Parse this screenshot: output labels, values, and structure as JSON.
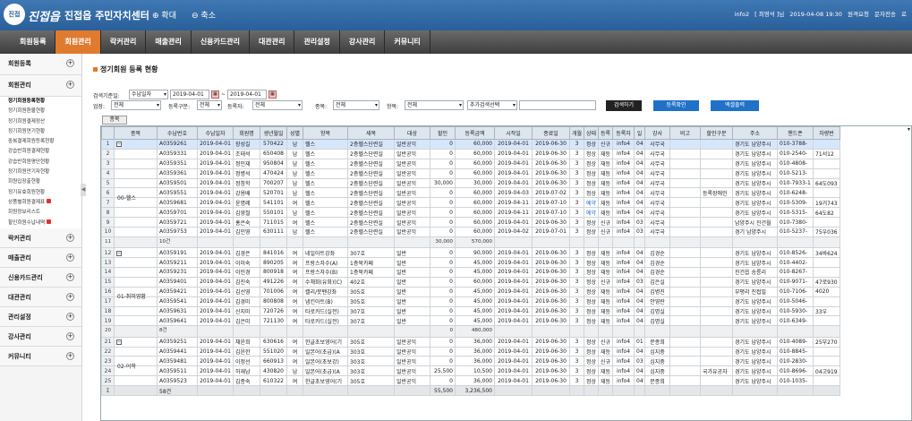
{
  "header": {
    "logo": "진접",
    "brand": "진접읍",
    "title": "진접읍 주민자치센터",
    "zoom_in": "확대",
    "zoom_out": "축소",
    "info": [
      "info2",
      "[ 최영석 ]님",
      "2019-04-08 19:30",
      "원격요청",
      "문자전송",
      "로"
    ]
  },
  "nav": [
    "회원등록",
    "회원관리",
    "락커관리",
    "매출관리",
    "신용카드관리",
    "대관관리",
    "관리설정",
    "강사관리",
    "커뮤니티"
  ],
  "nav_active": 1,
  "sidebar": {
    "top": [
      "회원등록",
      "회원관리"
    ],
    "subs": [
      "정기회원등록현황",
      "정기회원환불현황",
      "정기회원결제정산",
      "정기회원연기현황",
      "중복결제회원등록현황",
      "강습반회원결제현황",
      "강습반회원명단현황",
      "정기회원만기자현황",
      "회원입장출현황",
      "정기유효회원현황",
      "상품별회원결제표",
      "회원정보리스트",
      "할인회원수납내역"
    ],
    "locked": [
      10,
      12
    ],
    "bottom": [
      "락커관리",
      "매출관리",
      "신용카드관리",
      "대관관리",
      "관리설정",
      "강사관리",
      "커뮤니티"
    ]
  },
  "page": {
    "title": "정기회원 등록 현황"
  },
  "filters": {
    "period_label": "검색기준일:",
    "period_type": "수납일자",
    "date_from": "2019-04-01",
    "date_to": "2019-04-01",
    "business_label": "업장:",
    "business": "전체",
    "reg_label": "등록구분:",
    "reg": "전체",
    "reg_user_label": "등록자:",
    "reg_user": "전체",
    "type_label": "종목:",
    "type": "전체",
    "item_label": "항목:",
    "item": "전체",
    "extra": "추가검색선택"
  },
  "buttons": {
    "search": "검색하기",
    "register": "등록확인",
    "excel": "엑셀출력",
    "group": "종목"
  },
  "columns": [
    "",
    "종목",
    "수납번호",
    "수납일자",
    "회원명",
    "생년월일",
    "성별",
    "항목",
    "세목",
    "대상",
    "할인",
    "등록금액",
    "시작일",
    "종료일",
    "개월",
    "상태",
    "등록",
    "등록자",
    "일",
    "강사",
    "비고",
    "할인구분",
    "주소",
    "핸드폰",
    "차량번"
  ],
  "rows": [
    {
      "rn": "1",
      "g": "⊟",
      "no": "A0359261",
      "d": "2019-04-01",
      "n": "장성길",
      "b": "570422",
      "s": "남",
      "i": "헬스",
      "t": "2층헬스단련실",
      "tg": "일반공익",
      "dc": "0",
      "amt": "60,000",
      "st": "2019-04-01",
      "en": "2019-06-30",
      "m": "3",
      "ss": "정상",
      "rg": "신규",
      "ru": "info4",
      "dy": "04",
      "tc": "사무국",
      "nt": "",
      "dk": "",
      "ad": "경기도 남양주시",
      "ph": "010-3788-",
      "car": ""
    },
    {
      "rn": "2",
      "g": "",
      "no": "A0359331",
      "d": "2019-04-01",
      "n": "조태석",
      "b": "650408",
      "s": "남",
      "i": "헬스",
      "t": "2층헬스단련실",
      "tg": "일반공익",
      "dc": "0",
      "amt": "60,000",
      "st": "2019-04-01",
      "en": "2019-06-30",
      "m": "3",
      "ss": "정상",
      "rg": "재등",
      "ru": "info4",
      "dy": "04",
      "tc": "사무국",
      "nt": "",
      "dk": "",
      "ad": "경기도 남양주시",
      "ph": "010-2540-",
      "car": "71서12"
    },
    {
      "rn": "3",
      "g": "",
      "no": "A0359351",
      "d": "2019-04-01",
      "n": "정민재",
      "b": "950804",
      "s": "남",
      "i": "헬스",
      "t": "2층헬스단련실",
      "tg": "일반공익",
      "dc": "0",
      "amt": "60,000",
      "st": "2019-04-01",
      "en": "2019-06-30",
      "m": "3",
      "ss": "정상",
      "rg": "재등",
      "ru": "info4",
      "dy": "04",
      "tc": "사무국",
      "nt": "",
      "dk": "",
      "ad": "경기도 남양주시",
      "ph": "010-4808-",
      "car": ""
    },
    {
      "rn": "4",
      "g": "",
      "no": "A0359361",
      "d": "2019-04-01",
      "n": "정병석",
      "b": "470424",
      "s": "남",
      "i": "헬스",
      "t": "2층헬스단련실",
      "tg": "일반공익",
      "dc": "0",
      "amt": "60,000",
      "st": "2019-04-01",
      "en": "2019-06-30",
      "m": "3",
      "ss": "정상",
      "rg": "재등",
      "ru": "info4",
      "dy": "04",
      "tc": "사무국",
      "nt": "",
      "dk": "",
      "ad": "경기도 남양주시",
      "ph": "010-5213-",
      "car": ""
    },
    {
      "rn": "5",
      "g": "",
      "no": "A0359501",
      "d": "2019-04-01",
      "n": "정창학",
      "b": "700207",
      "s": "남",
      "i": "헬스",
      "t": "2층헬스단련실",
      "tg": "일반공익",
      "dc": "30,000",
      "amt": "30,000",
      "st": "2019-04-01",
      "en": "2019-06-30",
      "m": "3",
      "ss": "정상",
      "rg": "재등",
      "ru": "info4",
      "dy": "04",
      "tc": "사무국",
      "nt": "",
      "dk": "",
      "ad": "경기도 남양주시",
      "ph": "010-7933-1",
      "car": "64도093"
    },
    {
      "rn": "6",
      "g": "",
      "no": "A0359551",
      "d": "2019-04-01",
      "n": "강용배",
      "b": "520701",
      "s": "남",
      "i": "헬스",
      "t": "2층헬스단련실",
      "tg": "일반공익",
      "dc": "0",
      "amt": "60,000",
      "st": "2019-04-03",
      "en": "2019-07-02",
      "m": "3",
      "ss": "정상",
      "rg": "재등",
      "ru": "info4",
      "dy": "04",
      "tc": "사무국",
      "nt": "",
      "dk": "등록장애인",
      "ad": "경기도 남양주시",
      "ph": "010-6248-",
      "car": ""
    },
    {
      "rn": "7",
      "g": "",
      "no": "A0359681",
      "d": "2019-04-01",
      "n": "윤명례",
      "b": "541101",
      "s": "여",
      "i": "헬스",
      "t": "2층헬스단련실",
      "tg": "일반공익",
      "dc": "0",
      "amt": "60,000",
      "st": "2019-04-11",
      "en": "2019-07-10",
      "m": "3",
      "ss": "예약",
      "rg": "재등",
      "ru": "info4",
      "dy": "04",
      "tc": "사무국",
      "nt": "",
      "dk": "",
      "ad": "경기도 남양주시",
      "ph": "010-5309-",
      "car": "19거743"
    },
    {
      "rn": "8",
      "g": "",
      "no": "A0359701",
      "d": "2019-04-01",
      "n": "김영철",
      "b": "550101",
      "s": "남",
      "i": "헬스",
      "t": "2층헬스단련실",
      "tg": "일반공익",
      "dc": "0",
      "amt": "60,000",
      "st": "2019-04-11",
      "en": "2019-07-10",
      "m": "3",
      "ss": "예약",
      "rg": "재등",
      "ru": "info4",
      "dy": "04",
      "tc": "사무국",
      "nt": "",
      "dk": "",
      "ad": "경기도 남양주시",
      "ph": "010-5315-",
      "car": "64도82"
    },
    {
      "rn": "9",
      "g": "",
      "no": "A0359721",
      "d": "2019-04-01",
      "n": "홍은숙",
      "b": "711015",
      "s": "여",
      "i": "헬스",
      "t": "2층헬스단련실",
      "tg": "일반공익",
      "dc": "0",
      "amt": "60,000",
      "st": "2019-04-01",
      "en": "2019-06-30",
      "m": "3",
      "ss": "정상",
      "rg": "신규",
      "ru": "info4",
      "dy": "03",
      "tc": "사무국",
      "nt": "",
      "dk": "",
      "ad": "남양주시 진건월",
      "ph": "010-7380-",
      "car": ""
    },
    {
      "rn": "10",
      "g": "",
      "no": "A0359753",
      "d": "2019-04-01",
      "n": "김민영",
      "b": "630111",
      "s": "남",
      "i": "헬스",
      "t": "2층헬스단련실",
      "tg": "일반공익",
      "dc": "0",
      "amt": "60,000",
      "st": "2019-04-02",
      "en": "2019-07-01",
      "m": "3",
      "ss": "정상",
      "rg": "신규",
      "ru": "info4",
      "dy": "03",
      "tc": "사무국",
      "nt": "",
      "dk": "",
      "ad": "경기 남양주시",
      "ph": "010-5237-",
      "car": "75우036"
    },
    {
      "rn": "11",
      "cls": "sub",
      "g": "",
      "no": "10건",
      "d": "",
      "n": "",
      "b": "",
      "s": "",
      "i": "",
      "t": "",
      "tg": "",
      "dc": "30,000",
      "amt": "570,000",
      "st": "",
      "en": "",
      "m": "",
      "ss": "",
      "rg": "",
      "ru": "",
      "dy": "",
      "tc": "",
      "nt": "",
      "dk": "",
      "ad": "",
      "ph": "",
      "car": ""
    },
    {
      "rn": "12",
      "g": "⊟",
      "no": "A0359191",
      "d": "2019-04-01",
      "n": "김경은",
      "b": "841016",
      "s": "여",
      "i": "네일아트강좌",
      "t": "307호",
      "tg": "일반",
      "dc": "0",
      "amt": "90,000",
      "st": "2019-04-01",
      "en": "2019-06-30",
      "m": "3",
      "ss": "정상",
      "rg": "재등",
      "ru": "info4",
      "dy": "04",
      "tc": "김경순",
      "nt": "",
      "dk": "",
      "ad": "경기도 남양주시",
      "ph": "010-8526-",
      "car": "34바624"
    },
    {
      "rn": "13",
      "g": "",
      "no": "A0359211",
      "d": "2019-04-01",
      "n": "이미숙",
      "b": "890205",
      "s": "여",
      "i": "프랑스자수(A)",
      "t": "1층북카페",
      "tg": "일반",
      "dc": "0",
      "amt": "45,000",
      "st": "2019-04-01",
      "en": "2019-06-30",
      "m": "3",
      "ss": "정상",
      "rg": "재등",
      "ru": "info4",
      "dy": "04",
      "tc": "김경순",
      "nt": "",
      "dk": "",
      "ad": "경기도 남양주시",
      "ph": "010-4402-",
      "car": ""
    },
    {
      "rn": "14",
      "g": "",
      "no": "A0359231",
      "d": "2019-04-01",
      "n": "이민경",
      "b": "800918",
      "s": "여",
      "i": "프랑스자수(B)",
      "t": "1층북카페",
      "tg": "일반",
      "dc": "0",
      "amt": "45,000",
      "st": "2019-04-01",
      "en": "2019-06-30",
      "m": "3",
      "ss": "정상",
      "rg": "재등",
      "ru": "info4",
      "dy": "04",
      "tc": "김경순",
      "nt": "",
      "dk": "",
      "ad": "진건읍 송릉리",
      "ph": "010-8267-",
      "car": ""
    },
    {
      "rn": "15",
      "g": "",
      "no": "A0359401",
      "d": "2019-04-01",
      "n": "김진숙",
      "b": "491226",
      "s": "여",
      "i": "수채화(유화)(C)",
      "t": "402호",
      "tg": "일반",
      "dc": "0",
      "amt": "60,000",
      "st": "2019-04-01",
      "en": "2019-06-30",
      "m": "3",
      "ss": "정상",
      "rg": "신규",
      "ru": "info4",
      "dy": "03",
      "tc": "김은실",
      "nt": "",
      "dk": "",
      "ad": "경기도 남양주시",
      "ph": "010-9071-",
      "car": "47로930"
    },
    {
      "rn": "16",
      "g": "",
      "no": "A0359421",
      "d": "2019-04-01",
      "n": "김선영",
      "b": "701006",
      "s": "여",
      "i": "캘리/붓펜강좌",
      "t": "305호",
      "tg": "일반",
      "dc": "0",
      "amt": "45,000",
      "st": "2019-04-01",
      "en": "2019-06-30",
      "m": "3",
      "ss": "정상",
      "rg": "재등",
      "ru": "info4",
      "dy": "04",
      "tc": "김병진",
      "nt": "",
      "dk": "",
      "ad": "부평리 진접빌",
      "ph": "010-7106-",
      "car": "4020"
    },
    {
      "rn": "17",
      "g": "",
      "no": "A0359541",
      "d": "2019-04-01",
      "n": "김경미",
      "b": "800808",
      "s": "여",
      "i": "냅킨아트(B)",
      "t": "305호",
      "tg": "일반",
      "dc": "0",
      "amt": "45,000",
      "st": "2019-04-01",
      "en": "2019-06-30",
      "m": "3",
      "ss": "정상",
      "rg": "재등",
      "ru": "info4",
      "dy": "04",
      "tc": "안영란",
      "nt": "",
      "dk": "",
      "ad": "경기도 남양주시",
      "ph": "010-5046-",
      "car": ""
    },
    {
      "rn": "18",
      "g": "",
      "no": "A0359631",
      "d": "2019-04-01",
      "n": "신지미",
      "b": "720726",
      "s": "여",
      "i": "타로카드(실전)",
      "t": "307호",
      "tg": "일반",
      "dc": "0",
      "amt": "45,000",
      "st": "2019-04-01",
      "en": "2019-06-30",
      "m": "3",
      "ss": "정상",
      "rg": "재등",
      "ru": "info4",
      "dy": "04",
      "tc": "김명실",
      "nt": "",
      "dk": "",
      "ad": "경기도 남양주시",
      "ph": "010-5930-",
      "car": "33우"
    },
    {
      "rn": "19",
      "g": "",
      "no": "A0359641",
      "d": "2019-04-01",
      "n": "김은미",
      "b": "721130",
      "s": "여",
      "i": "타로카드(실전)",
      "t": "307호",
      "tg": "일반",
      "dc": "0",
      "amt": "45,000",
      "st": "2019-04-01",
      "en": "2019-06-30",
      "m": "3",
      "ss": "정상",
      "rg": "재등",
      "ru": "info4",
      "dy": "04",
      "tc": "김명실",
      "nt": "",
      "dk": "",
      "ad": "경기도 남양주시",
      "ph": "010-6349-",
      "car": ""
    },
    {
      "rn": "20",
      "cls": "sub",
      "g": "",
      "no": "8건",
      "d": "",
      "n": "",
      "b": "",
      "s": "",
      "i": "",
      "t": "",
      "tg": "",
      "dc": "0",
      "amt": "480,000",
      "st": "",
      "en": "",
      "m": "",
      "ss": "",
      "rg": "",
      "ru": "",
      "dy": "",
      "tc": "",
      "nt": "",
      "dk": "",
      "ad": "",
      "ph": "",
      "car": ""
    },
    {
      "rn": "21",
      "g": "⊟",
      "no": "A0359251",
      "d": "2019-04-01",
      "n": "채윤희",
      "b": "630616",
      "s": "여",
      "i": "한글초보영어(기",
      "t": "305호",
      "tg": "일반공익",
      "dc": "0",
      "amt": "36,000",
      "st": "2019-04-01",
      "en": "2019-06-30",
      "m": "3",
      "ss": "정상",
      "rg": "신규",
      "ru": "info4",
      "dy": "01",
      "tc": "문종희",
      "nt": "",
      "dk": "",
      "ad": "경기도 남양주시",
      "ph": "010-4089-",
      "car": "25부270"
    },
    {
      "rn": "22",
      "g": "",
      "no": "A0359441",
      "d": "2019-04-01",
      "n": "김윤한",
      "b": "551020",
      "s": "여",
      "i": "일본어(초급)(A",
      "t": "303호",
      "tg": "일반공익",
      "dc": "0",
      "amt": "36,000",
      "st": "2019-04-01",
      "en": "2019-06-30",
      "m": "3",
      "ss": "정상",
      "rg": "재등",
      "ru": "info4",
      "dy": "04",
      "tc": "심지중",
      "nt": "",
      "dk": "",
      "ad": "경기도 남양주시",
      "ph": "010-8845-",
      "car": ""
    },
    {
      "rn": "23",
      "g": "",
      "no": "A0359481",
      "d": "2019-04-01",
      "n": "이정선",
      "b": "660913",
      "s": "여",
      "i": "일본어(초보강)",
      "t": "303호",
      "tg": "일반공익",
      "dc": "0",
      "amt": "36,000",
      "st": "2019-04-01",
      "en": "2019-06-30",
      "m": "3",
      "ss": "정상",
      "rg": "신규",
      "ru": "info4",
      "dy": "03",
      "tc": "심지중",
      "nt": "",
      "dk": "",
      "ad": "경기도 남양주시",
      "ph": "010-2830-",
      "car": ""
    },
    {
      "rn": "24",
      "g": "",
      "no": "A0359511",
      "d": "2019-04-01",
      "n": "허재남",
      "b": "430820",
      "s": "남",
      "i": "일본어(초급)(A",
      "t": "303호",
      "tg": "일반공익",
      "dc": "25,500",
      "amt": "10,500",
      "st": "2019-04-01",
      "en": "2019-06-30",
      "m": "3",
      "ss": "정상",
      "rg": "재등",
      "ru": "info4",
      "dy": "04",
      "tc": "심지중",
      "nt": "",
      "dk": "국가유공자",
      "ad": "경기도 남양주시",
      "ph": "010-8696-",
      "car": "04고919"
    },
    {
      "rn": "25",
      "g": "",
      "no": "A0359523",
      "d": "2019-04-01",
      "n": "김종숙",
      "b": "610322",
      "s": "여",
      "i": "한글초보영어(기",
      "t": "305호",
      "tg": "일반공익",
      "dc": "0",
      "amt": "36,000",
      "st": "2019-04-01",
      "en": "2019-06-30",
      "m": "3",
      "ss": "정상",
      "rg": "재등",
      "ru": "info4",
      "dy": "04",
      "tc": "문종희",
      "nt": "",
      "dk": "",
      "ad": "경기도 남양주시",
      "ph": "010-1035-",
      "car": ""
    },
    {
      "rn": "Σ",
      "cls": "tot",
      "g": "",
      "no": "58건",
      "d": "",
      "n": "",
      "b": "",
      "s": "",
      "i": "",
      "t": "",
      "tg": "",
      "dc": "55,500",
      "amt": "3,236,500",
      "st": "",
      "en": "",
      "m": "",
      "ss": "",
      "rg": "",
      "ru": "",
      "dy": "",
      "tc": "",
      "nt": "",
      "dk": "",
      "ad": "",
      "ph": "",
      "car": ""
    }
  ],
  "groups": [
    {
      "label": "00-헬스",
      "at": 0,
      "span": 11
    },
    {
      "label": "01-취미영황",
      "at": 11,
      "span": 9
    },
    {
      "label": "02-어학",
      "at": 20,
      "span": 5
    }
  ],
  "selected_row": 0
}
